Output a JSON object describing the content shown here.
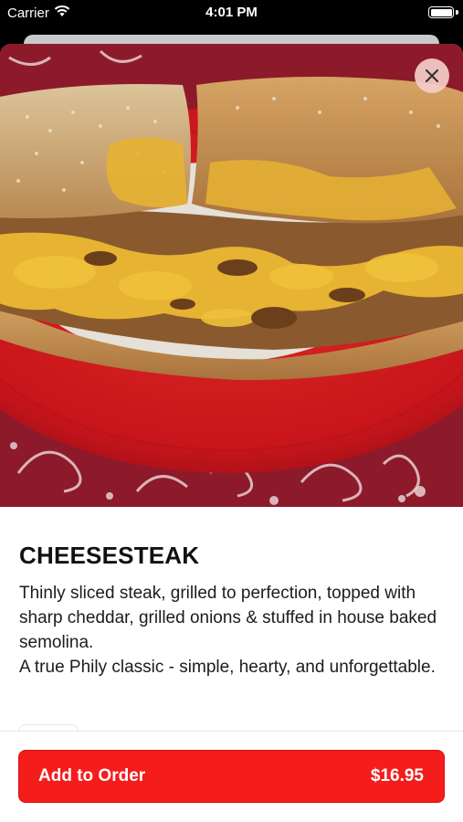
{
  "status_bar": {
    "carrier": "Carrier",
    "time": "4:01 PM"
  },
  "item": {
    "title": "CHEESESTEAK",
    "description": "Thinly sliced steak, grilled to perfection, topped with sharp cheddar, grilled onions & stuffed in house baked semolina.\nA true Phily classic - simple, hearty, and unforgettable."
  },
  "footer": {
    "button_label": "Add to Order",
    "price": "$16.95"
  },
  "colors": {
    "accent": "#f51c1c",
    "plate": "#c8151b",
    "tablecloth": "#8c1a2a",
    "cheese": "#e7b332",
    "bread": "#caa16a"
  },
  "icons": {
    "close": "close-icon",
    "wifi": "wifi-icon",
    "battery": "battery-icon"
  }
}
